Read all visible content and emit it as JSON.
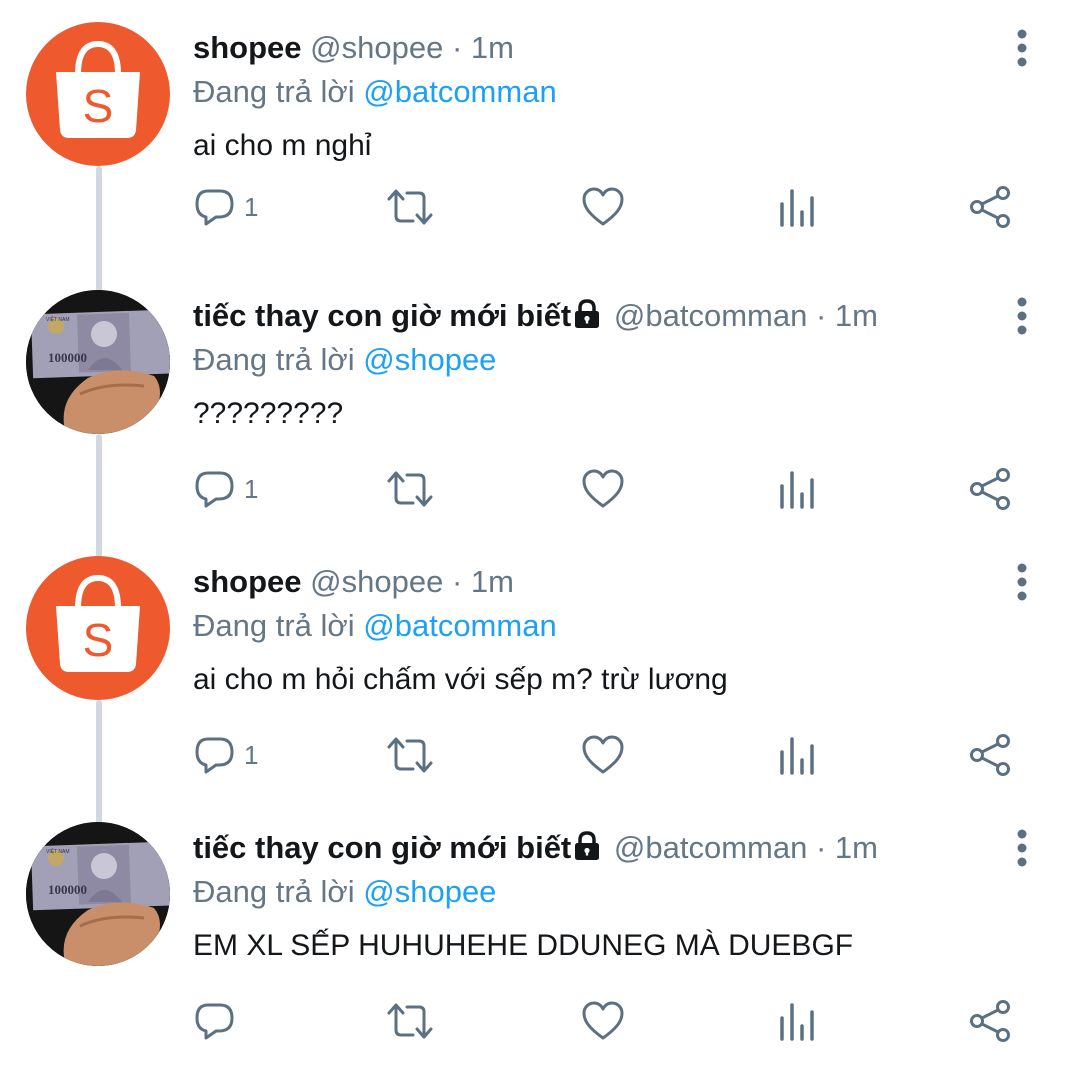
{
  "tweets": [
    {
      "avatar": "shopee-bag-logo",
      "name": "shopee",
      "handle": "@shopee",
      "dot": "·",
      "time": "1m",
      "locked": false,
      "reply_prefix": "Đang trả lời",
      "reply_to": "@batcomman",
      "text": "ai cho m nghỉ",
      "reply_count": "1"
    },
    {
      "avatar": "banknote-photo",
      "name": "tiếc thay con giờ mới biết",
      "handle": "@batcomman",
      "dot": "·",
      "time": "1m",
      "locked": true,
      "reply_prefix": "Đang trả lời",
      "reply_to": "@shopee",
      "text": "?????????",
      "reply_count": "1"
    },
    {
      "avatar": "shopee-bag-logo",
      "name": "shopee",
      "handle": "@shopee",
      "dot": "·",
      "time": "1m",
      "locked": false,
      "reply_prefix": "Đang trả lời",
      "reply_to": "@batcomman",
      "text": "ai cho m hỏi chấm với sếp m? trừ lương",
      "reply_count": "1"
    },
    {
      "avatar": "banknote-photo",
      "name": "tiếc thay con giờ mới biết",
      "handle": "@batcomman",
      "dot": "·",
      "time": "1m",
      "locked": true,
      "reply_prefix": "Đang trả lời",
      "reply_to": "@shopee",
      "text": "EM XL SẾP HUHUHEHE DDUNEG MÀ DUEBGF",
      "reply_count": ""
    }
  ],
  "icons": {
    "reply": "reply-icon",
    "retweet": "retweet-icon",
    "like": "like-icon",
    "analytics": "analytics-icon",
    "share": "share-icon",
    "more": "more-icon",
    "lock": "lock-icon"
  },
  "colors": {
    "shopee_orange": "#ee5a2e",
    "link_blue": "#1da1f2",
    "secondary_gray": "#657786",
    "icon_gray": "#5b7083",
    "thread_line": "#cfd9de"
  },
  "banknote_text": {
    "value": "100000",
    "country": "VIỆT NAM"
  }
}
